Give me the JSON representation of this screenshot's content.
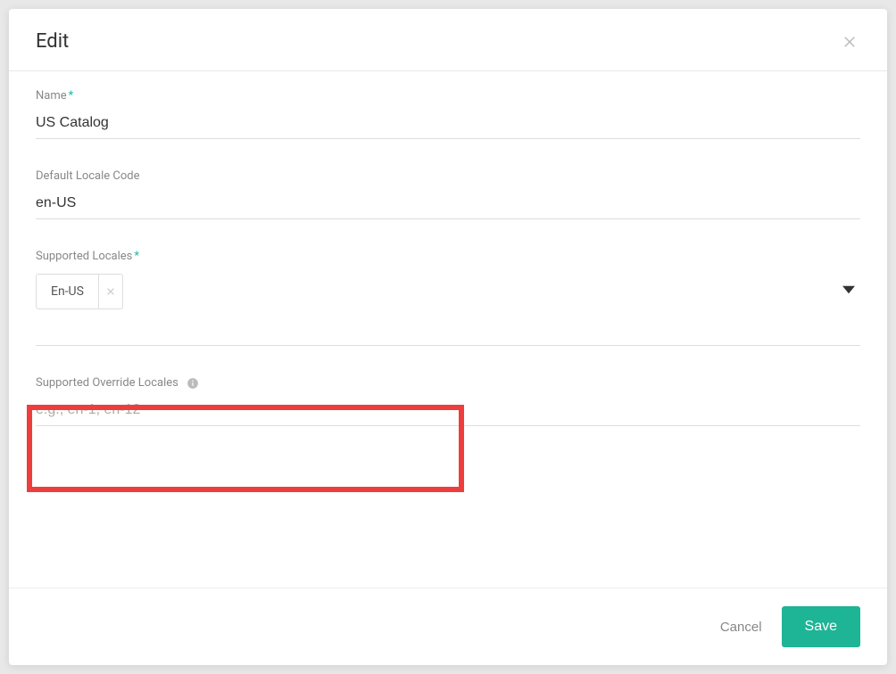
{
  "dialog": {
    "title": "Edit",
    "fields": {
      "name": {
        "label": "Name",
        "required": true,
        "value": "US Catalog"
      },
      "defaultLocale": {
        "label": "Default Locale Code",
        "required": false,
        "value": "en-US"
      },
      "supportedLocales": {
        "label": "Supported Locales",
        "required": true,
        "tags": [
          "En-US"
        ]
      },
      "overrideLocales": {
        "label": "Supported Override Locales",
        "required": false,
        "placeholder": "e.g., en-1, en-12",
        "value": ""
      }
    },
    "footer": {
      "cancel": "Cancel",
      "save": "Save"
    }
  }
}
